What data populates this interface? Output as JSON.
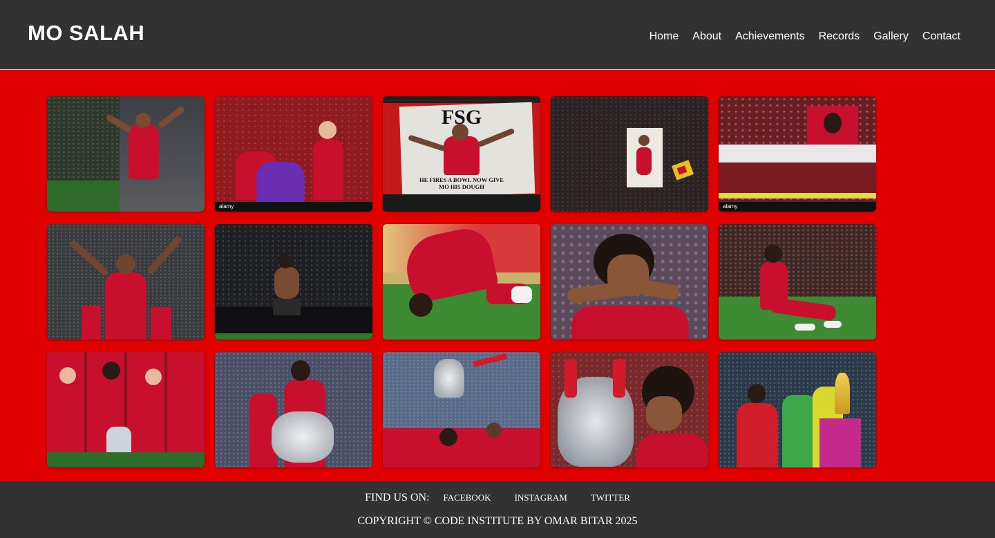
{
  "header": {
    "brand": "MO SALAH",
    "nav": [
      "Home",
      "About",
      "Achievements",
      "Records",
      "Gallery",
      "Contact"
    ]
  },
  "gallery": {
    "images": [
      {
        "name": "celebrating-with-fans",
        "bg": "#2d3a2c",
        "watermark": ""
      },
      {
        "name": "fans-crowd-selfie",
        "bg": "#8f1a1f",
        "watermark": "alamy"
      },
      {
        "name": "fsg-banner",
        "bg": "#d7d4cd",
        "watermark": "",
        "banner_top": "FSG",
        "banner_bottom": "HE FIRES A BOWL NOW GIVE MO HIS DOUGH"
      },
      {
        "name": "kop-banner-flag",
        "bg": "#262626",
        "watermark": ""
      },
      {
        "name": "stands-flag-portrait",
        "bg": "#6b1e22",
        "watermark": "alamy"
      },
      {
        "name": "arms-raised-celebration",
        "bg": "#3a3b3e",
        "watermark": ""
      },
      {
        "name": "shirtless-celebration",
        "bg": "#1e1f23",
        "watermark": ""
      },
      {
        "name": "sujood-prayer",
        "bg": "#c9b06b",
        "watermark": ""
      },
      {
        "name": "closeup-celebration",
        "bg": "#5a4a5a",
        "watermark": ""
      },
      {
        "name": "sitting-on-pitch",
        "bg": "#3a2a2a",
        "watermark": ""
      },
      {
        "name": "premier-league-trophy",
        "bg": "#6a1e1e",
        "watermark": ""
      },
      {
        "name": "community-shield",
        "bg": "#4a5068",
        "watermark": ""
      },
      {
        "name": "champions-league-lift",
        "bg": "#5a6b8a",
        "watermark": ""
      },
      {
        "name": "kissing-trophy",
        "bg": "#7a2a2a",
        "watermark": ""
      },
      {
        "name": "afcon-final",
        "bg": "#2a3a4a",
        "watermark": ""
      }
    ]
  },
  "colors": {
    "page_bg": "#e00000",
    "bar_bg": "#323232",
    "kit_red": "#c8102e"
  },
  "footer": {
    "find_us": "FIND US ON:",
    "social": [
      "FACEBOOK",
      "INSTAGRAM",
      "TWITTER"
    ],
    "copyright": "COPYRIGHT © CODE INSTITUTE BY OMAR BITAR 2025"
  }
}
